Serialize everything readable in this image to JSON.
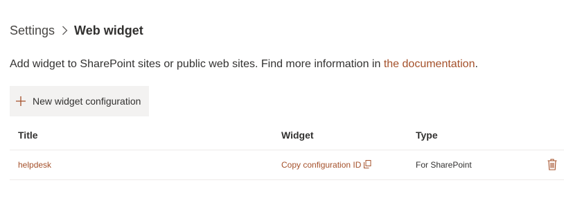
{
  "breadcrumb": {
    "root": "Settings",
    "current": "Web widget",
    "separator_icon": "chevron-right-icon"
  },
  "description": {
    "text": "Add widget to SharePoint sites or public web sites. Find more information in ",
    "link_text": "the documentation",
    "suffix": "."
  },
  "toolbar": {
    "new_label": "New widget configuration",
    "new_icon": "plus-icon"
  },
  "table": {
    "columns": [
      "Title",
      "Widget",
      "Type"
    ],
    "rows": [
      {
        "title": "helpdesk",
        "widget": "Copy configuration ID",
        "widget_icon": "copy-icon",
        "type": "For SharePoint",
        "action_icon": "trash-icon"
      }
    ]
  },
  "colors": {
    "accent": "#a4502a",
    "button_bg": "#f3f2f1",
    "text": "#323130",
    "divider": "#edebe9"
  }
}
